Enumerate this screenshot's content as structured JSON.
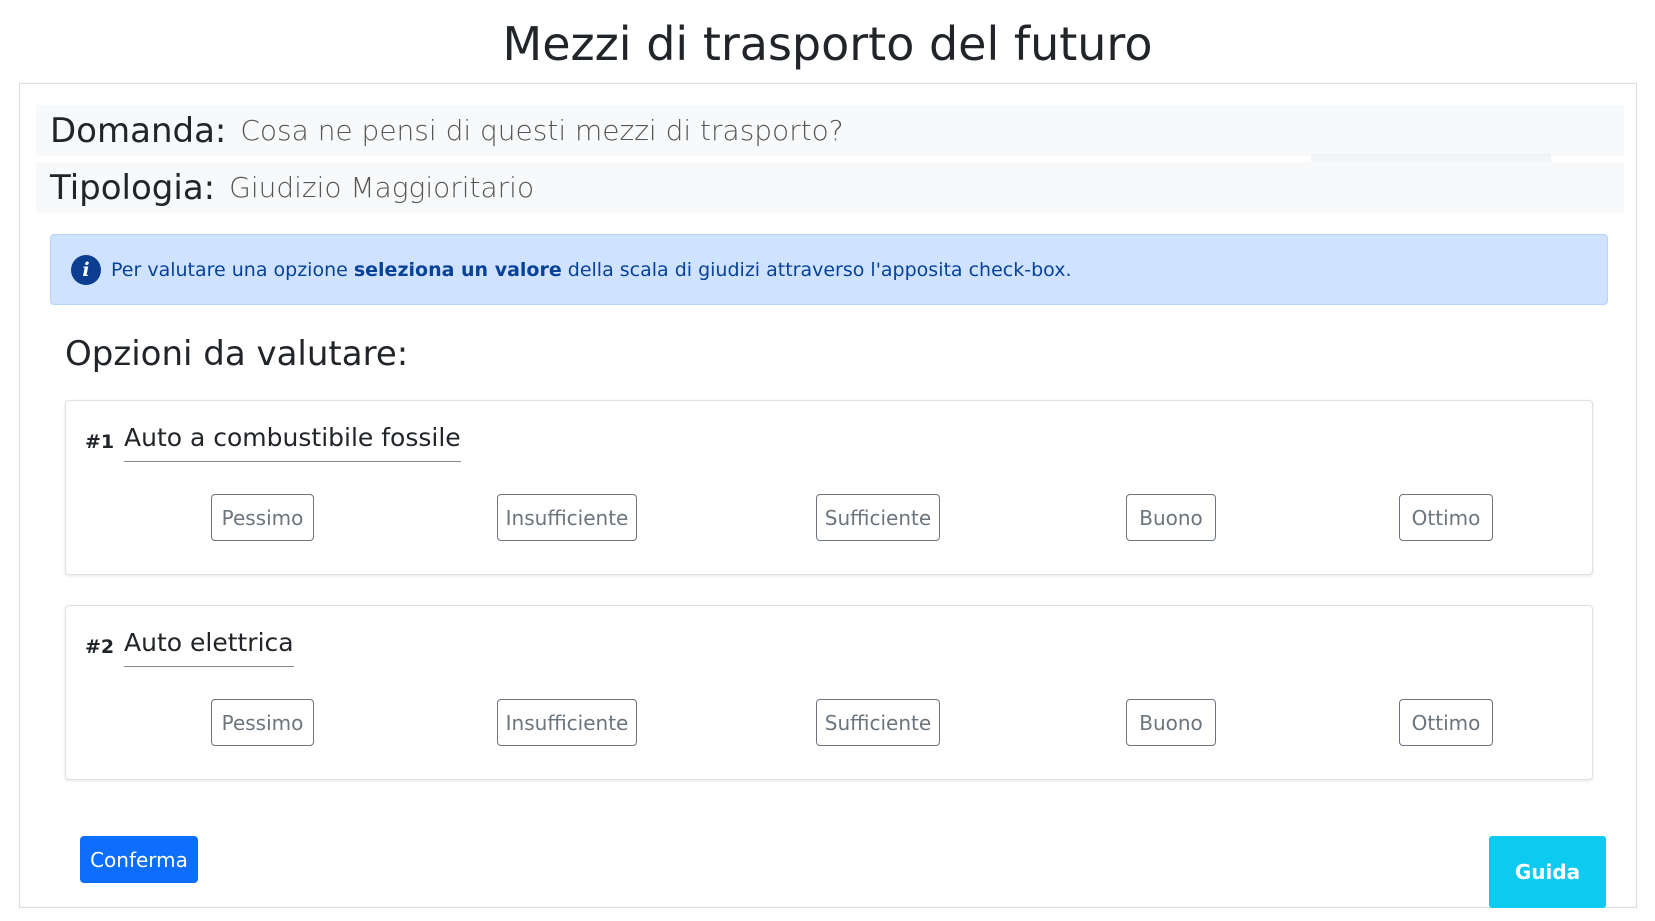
{
  "page": {
    "title": "Mezzi di trasporto del futuro"
  },
  "question": {
    "label": "Domanda:",
    "value": "Cosa ne pensi di questi mezzi di trasporto?"
  },
  "type": {
    "label": "Tipologia:",
    "value": "Giudizio Maggioritario"
  },
  "alert": {
    "icon": "info-icon",
    "text_before": "Per valutare una opzione ",
    "text_bold": "seleziona un valore",
    "text_after": " della scala di giudizi attraverso l'apposita check-box."
  },
  "options_heading": "Opzioni da valutare:",
  "options": [
    {
      "number": "#1",
      "title": "Auto a combustibile fossile",
      "ratings": [
        "Pessimo",
        "Insufficiente",
        "Sufficiente",
        "Buono",
        "Ottimo"
      ]
    },
    {
      "number": "#2",
      "title": "Auto elettrica",
      "ratings": [
        "Pessimo",
        "Insufficiente",
        "Sufficiente",
        "Buono",
        "Ottimo"
      ]
    }
  ],
  "actions": {
    "confirm_label": "Conferma",
    "help_label": "Guida"
  },
  "colors": {
    "primary": "#0d6efd",
    "info": "#0dcaf0",
    "alert_bg": "#cfe2ff",
    "alert_text": "#084298"
  }
}
